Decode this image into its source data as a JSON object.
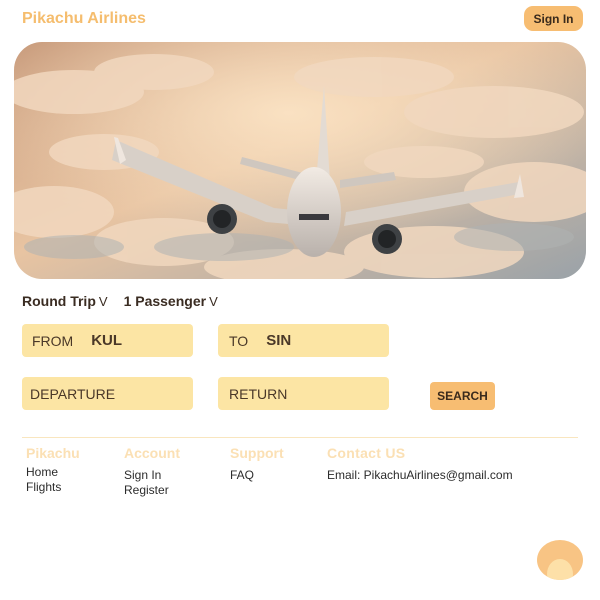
{
  "header": {
    "logo": "Pikachu Airlines",
    "signin_label": "Sign In"
  },
  "hero": {
    "image": "airplane flying above clouds at sunset"
  },
  "booking": {
    "trip_type": "Round Trip",
    "passengers": "1 Passenger",
    "caret": "V",
    "from_label": "FROM",
    "from_value": "KUL",
    "to_label": "TO",
    "to_value": "SIN",
    "departure_label": "DEPARTURE",
    "return_label": "RETURN",
    "search_label": "SEARCH"
  },
  "footer": {
    "columns": [
      {
        "title": "Pikachu",
        "links": [
          "Home",
          "Flights"
        ]
      },
      {
        "title": "Account",
        "links": [
          "Sign In",
          "Register"
        ]
      },
      {
        "title": "Support",
        "links": [
          "FAQ"
        ]
      },
      {
        "title": "Contact US",
        "links": [
          "Email: PikachuAirlines@gmail.com"
        ]
      }
    ]
  },
  "colors": {
    "accent": "#f7bd72",
    "field_bg": "#fce5a4",
    "logo": "#f5bd6e"
  },
  "icons": {
    "fab": "pikachu-ear-icon"
  }
}
